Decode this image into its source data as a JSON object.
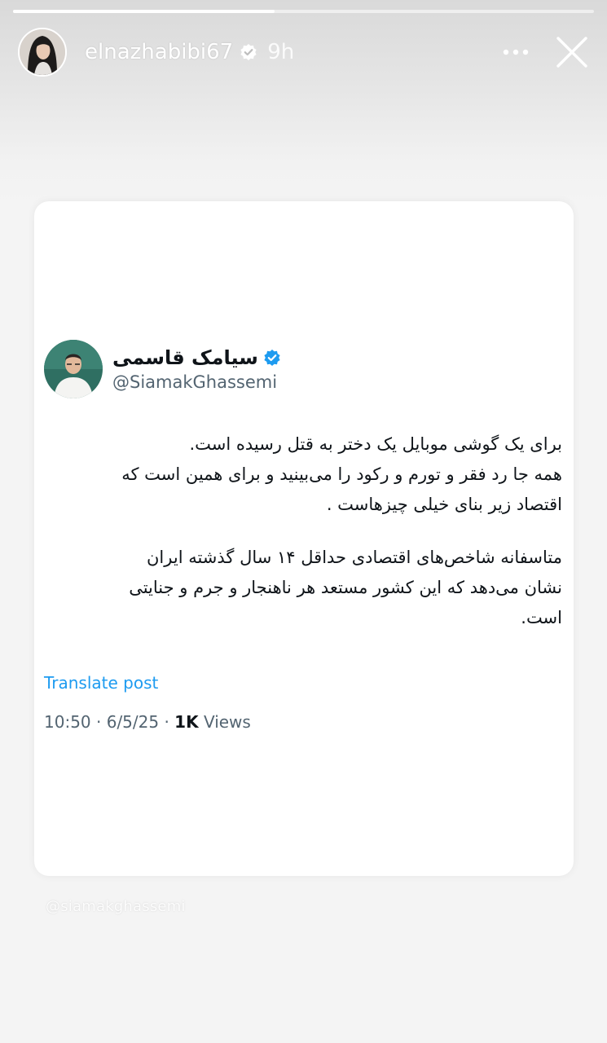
{
  "story": {
    "username": "elnazhabibi67",
    "time": "9h",
    "progress": 0.45,
    "icons": [
      "verified-icon",
      "more-icon",
      "close-icon"
    ]
  },
  "tweet": {
    "author_name": "سیامک قاسمی",
    "author_handle": "@SiamakGhassemi",
    "paragraphs": [
      [
        "برای یک گوشی موبایل یک دختر به قتل رسیده است.",
        "همه جا رد فقر و تورم و رکود را می‌بینید و برای همین است که",
        "اقتصاد زیر بنای خیلی چیزهاست ."
      ],
      [
        "متاسفانه شاخص‌های اقتصادی حداقل ۱۴ سال گذشته ایران",
        "نشان می‌دهد که این کشور مستعد هر ناهنجار و جرم و جنایتی",
        "است."
      ]
    ],
    "translate_label": "Translate post",
    "time": "10:50",
    "date": "6/5/25",
    "separator": "·",
    "views_count": "1K",
    "views_label": "Views"
  },
  "watermark": "@siamakghassemi",
  "colors": {
    "link": "#1d9bf0",
    "verified": "#1d9bf0",
    "text": "#0f1419",
    "muted": "#536471"
  }
}
